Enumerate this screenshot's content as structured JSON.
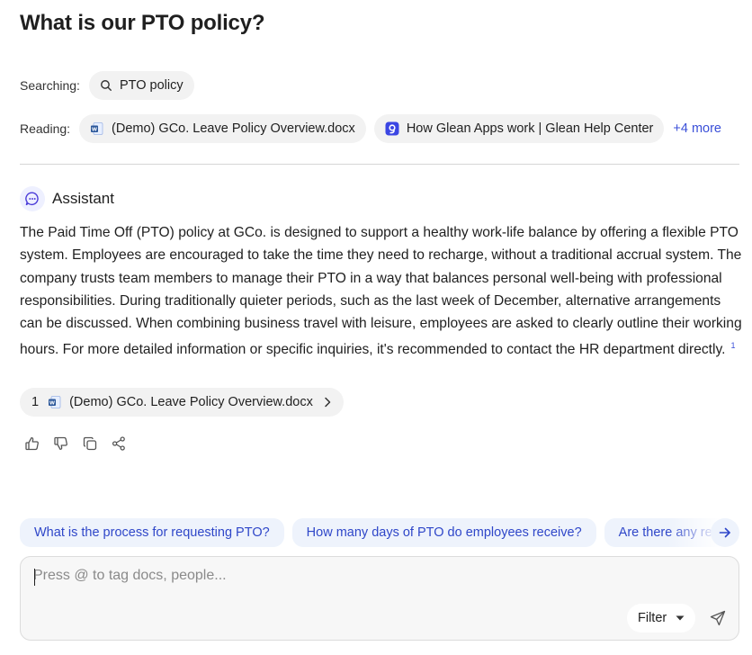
{
  "question": "What is our PTO policy?",
  "searching": {
    "label": "Searching:",
    "query": "PTO policy",
    "icon": "search-icon"
  },
  "reading": {
    "label": "Reading:",
    "sources": [
      {
        "title": "(Demo) GCo. Leave Policy Overview.docx",
        "icon": "word-doc-icon"
      },
      {
        "title": "How Glean Apps work | Glean Help Center",
        "icon": "glean-help-icon"
      }
    ],
    "more": "+4 more"
  },
  "assistant": {
    "name": "Assistant",
    "icon": "assistant-chat-icon",
    "answer": "The Paid Time Off (PTO) policy at GCo. is designed to support a healthy work-life balance by offering a flexible PTO system. Employees are encouraged to take the time they need to recharge, without a traditional accrual system. The company trusts team members to manage their PTO in a way that balances personal well-being with professional responsibilities. During traditionally quieter periods, such as the last week of December, alternative arrangements can be discussed. When combining business travel with leisure, employees are asked to clearly outline their working hours. For more detailed information or specific inquiries, it's recommended to contact the HR department directly.",
    "citation_marker": "1"
  },
  "citation": {
    "number": "1",
    "title": "(Demo) GCo. Leave Policy Overview.docx"
  },
  "actions": [
    "thumbs-up-icon",
    "thumbs-down-icon",
    "copy-icon",
    "share-icon"
  ],
  "suggestions": [
    "What is the process for requesting PTO?",
    "How many days of PTO do employees receive?",
    "Are there any restrictions on taking PTO?"
  ],
  "composer": {
    "placeholder": "Press @ to tag docs, people...",
    "filter_label": "Filter"
  },
  "colors": {
    "accent": "#3a4fd8",
    "suggestion_bg": "#eef3fc",
    "pill_bg": "#f2f2f2",
    "word_blue": "#2b579a",
    "glean_blue": "#3b46e3"
  }
}
